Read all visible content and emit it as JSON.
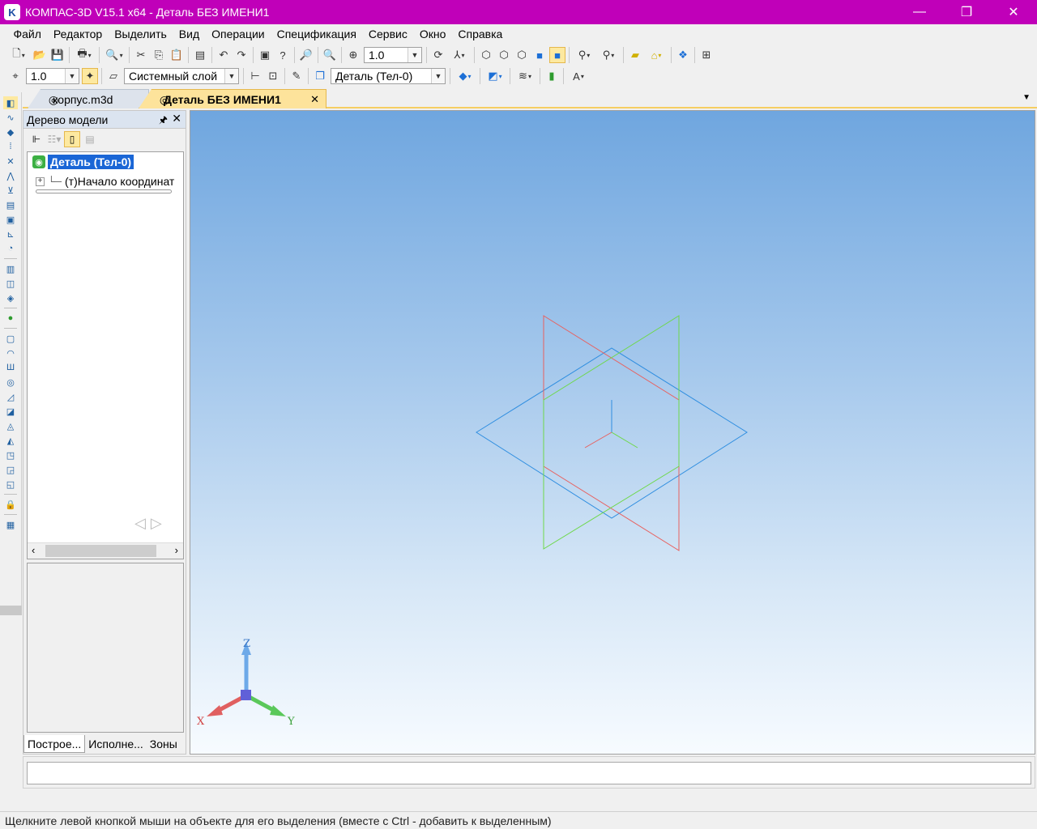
{
  "window": {
    "title": "КОМПАС-3D V15.1 x64 - Деталь БЕЗ ИМЕНИ1",
    "app_icon_letter": "K",
    "minimize": "—",
    "restore": "❐",
    "close": "✕"
  },
  "menu": [
    {
      "label": "Файл",
      "name": "menu-file"
    },
    {
      "label": "Редактор",
      "name": "menu-editor"
    },
    {
      "label": "Выделить",
      "name": "menu-select"
    },
    {
      "label": "Вид",
      "name": "menu-view"
    },
    {
      "label": "Операции",
      "name": "menu-operations"
    },
    {
      "label": "Спецификация",
      "name": "menu-specification"
    },
    {
      "label": "Сервис",
      "name": "menu-service"
    },
    {
      "label": "Окно",
      "name": "menu-window"
    },
    {
      "label": "Справка",
      "name": "menu-help"
    }
  ],
  "toolbar1": {
    "zoom_value": "1.0"
  },
  "toolbar2": {
    "step_value": "1.0",
    "layer": "Системный слой",
    "body": "Деталь (Тел-0)"
  },
  "tabs": [
    {
      "label": "корпус.m3d"
    },
    {
      "label": "Деталь БЕЗ ИМЕНИ1",
      "close": "✕"
    }
  ],
  "model_panel": {
    "title": "Дерево модели",
    "pin": "🖈",
    "close": "✕",
    "tree": {
      "root": "Деталь (Тел-0)",
      "child": "(т)Начало координат",
      "expander": "+"
    },
    "nav": "◁▷",
    "bottom_tabs": [
      "Построе...",
      "Исполне...",
      "Зоны"
    ]
  },
  "viewport": {
    "triad": {
      "x": "X",
      "y": "Y",
      "z": "Z"
    },
    "colors": {
      "xy_plane": "#2f8ee0",
      "zx_plane": "#e8605e",
      "zy_plane": "#6ed84a"
    }
  },
  "status": {
    "text": "Щелкните левой кнопкой мыши на объекте для его выделения (вместе с Ctrl - добавить к выделенным)"
  }
}
